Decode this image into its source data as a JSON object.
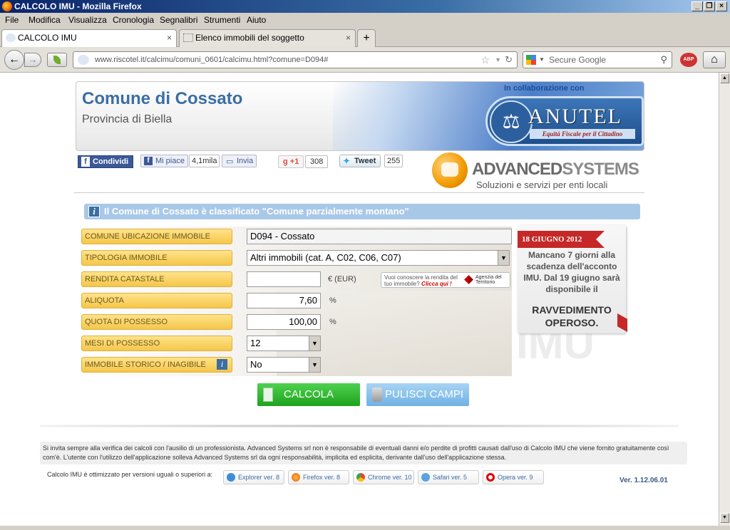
{
  "window": {
    "title": "CALCOLO IMU - Mozilla Firefox"
  },
  "menu": [
    "File",
    "Modifica",
    "Visualizza",
    "Cronologia",
    "Segnalibri",
    "Strumenti",
    "Aiuto"
  ],
  "tabs": [
    {
      "label": "CALCOLO IMU",
      "active": true
    },
    {
      "label": "Elenco immobili del soggetto",
      "active": false
    }
  ],
  "nav": {
    "url": "www.riscotel.it/calcimu/comuni_0601/calcimu.html?comune=D094#",
    "search_placeholder": "Secure Google"
  },
  "header": {
    "comune": "Comune di Cossato",
    "provincia": "Provincia di Biella",
    "collab": "In collaborazione con",
    "anutel": "ANUTEL",
    "anutel_tag": "Equità Fiscale per il Cittadino"
  },
  "social": {
    "condividi": "Condividi",
    "mipiace": "Mi piace",
    "mipiace_count": "4,1mila",
    "invia": "Invia",
    "gplus": "+1",
    "gplus_count": "308",
    "tweet": "Tweet",
    "tweet_count": "255"
  },
  "logo": {
    "name_a": "ADVANCED",
    "name_b": "SYSTEMS",
    "sub": "Soluzioni e servizi per enti locali"
  },
  "notice": "Il Comune di Cossato è classificato \"Comune parzialmente montano\"",
  "form": {
    "comune_label": "COMUNE UBICAZIONE IMMOBILE",
    "comune_value": "D094 - Cossato",
    "tipologia_label": "TIPOLOGIA IMMOBILE",
    "tipologia_value": "Altri immobili (cat. A, C02, C06, C07)",
    "rendita_label": "RENDITA CATASTALE",
    "rendita_value": "",
    "rendita_unit": "€ (EUR)",
    "aliquota_label": "ALIQUOTA",
    "aliquota_value": "7,60",
    "quota_label": "QUOTA DI POSSESSO",
    "quota_value": "100,00",
    "percent": "%",
    "mesi_label": "MESI DI POSSESSO",
    "mesi_value": "12",
    "storico_label": "IMMOBILE STORICO / INAGIBILE",
    "storico_value": "No"
  },
  "agenzia": {
    "text_a": "Vuoi conoscere la rendita del",
    "text_b": "tuo immobile?",
    "link": "Clicca qui !",
    "logo_a": "Agenzia del",
    "logo_b": "Territorio"
  },
  "promo": {
    "date": "18 GIUGNO 2012",
    "text": "Mancano 7 giorni alla scadenza dell'acconto IMU. Dal 19 giugno sarà disponibile il",
    "big": "RAVVEDIMENTO OPEROSO.",
    "watermark": "IMU"
  },
  "buttons": {
    "calcola": "CALCOLA",
    "pulisci": "PULISCI CAMPI"
  },
  "footer": {
    "disclaimer": "Si invita sempre alla verifica dei calcoli con l'ausilio di un professionista. Advanced Systems srl non è responsabile di eventuali danni e/o perdite di profitti causati dall'uso di Calcolo IMU che viene fornito gratuitamente così com'è. L'utente con l'utilizzo dell'applicazione solleva Advanced Systems srl da ogni responsabilità, implicita ed esplicita, derivante dall'uso dell'applicazione stessa.",
    "optimized": "Calcolo IMU è ottimizzato per versioni uguali o superiori a:",
    "browsers": [
      "Explorer ver. 8",
      "Firefox ver. 8",
      "Chrome ver. 10",
      "Safari ver. 5",
      "Opera ver. 9"
    ],
    "version": "Ver. 1.12.06.01"
  },
  "colors": {
    "accent": "#3a6ea5",
    "field_label": "#f5c64a",
    "calc_button": "#1ea31e",
    "ribbon": "#c62828"
  }
}
